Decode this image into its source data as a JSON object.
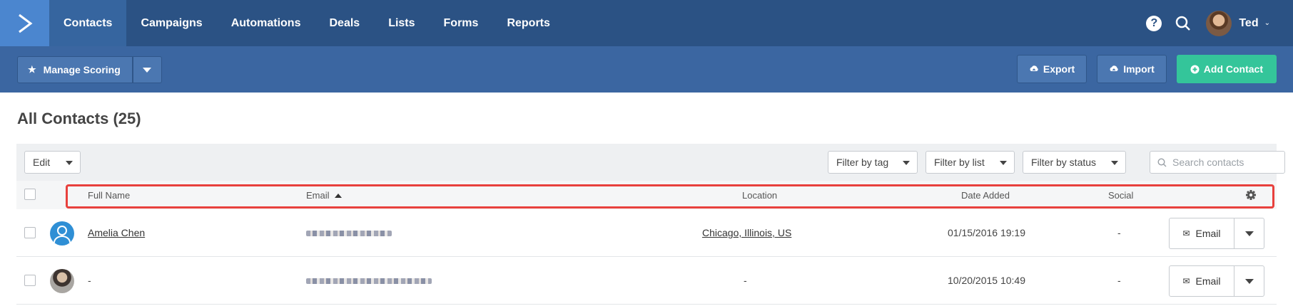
{
  "topnav": {
    "items": [
      "Contacts",
      "Campaigns",
      "Automations",
      "Deals",
      "Lists",
      "Forms",
      "Reports"
    ],
    "active": "Contacts",
    "help_label": "?",
    "user_name": "Ted"
  },
  "toolbar": {
    "manage_scoring": "Manage Scoring",
    "export": "Export",
    "import": "Import",
    "add_contact": "Add Contact"
  },
  "page": {
    "title": "All Contacts (25)"
  },
  "filters": {
    "edit": "Edit",
    "tag": "Filter by tag",
    "list": "Filter by list",
    "status": "Filter by status",
    "search_placeholder": "Search contacts"
  },
  "table": {
    "columns": {
      "full_name": "Full Name",
      "email": "Email",
      "location": "Location",
      "date_added": "Date Added",
      "social": "Social"
    },
    "rows": [
      {
        "name": "Amelia Chen",
        "location": "Chicago, Illinois, US",
        "date_added": "01/15/2016 19:19",
        "social": "-",
        "action": "Email"
      },
      {
        "name": "-",
        "location": "-",
        "date_added": "10/20/2015 10:49",
        "social": "-",
        "action": "Email"
      }
    ]
  },
  "colors": {
    "nav_bg": "#2b5284",
    "toolbar_bg": "#3b66a1",
    "accent_green": "#34c59a",
    "highlight": "#e8413d"
  }
}
